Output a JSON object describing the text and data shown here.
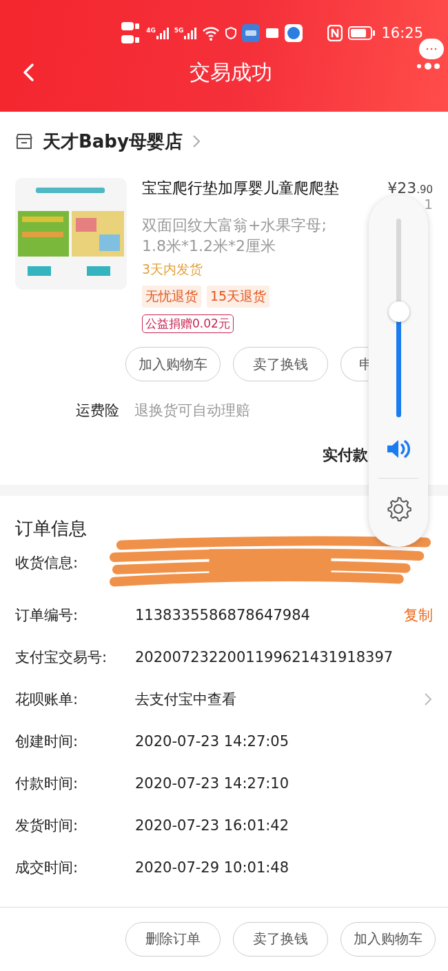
{
  "status_bar": {
    "network_labels": [
      "4G",
      "5G"
    ],
    "time": "16:25"
  },
  "header": {
    "title": "交易成功"
  },
  "shop": {
    "name": "天才Baby母婴店"
  },
  "product": {
    "image": {
      "kind": "picture"
    },
    "title": "宝宝爬行垫加厚婴儿童爬爬垫",
    "price_symbol": "¥",
    "price_integer": "23",
    "price_decimal": ".90",
    "quantity": "1",
    "spec_lines": [
      "双面回纹大富翁+水果字母;",
      "1.8米*1.2米*2厘米"
    ],
    "delivery": "3天内发货",
    "tags": [
      "无忧退货",
      "15天退货"
    ],
    "charity": "公益捐赠0.02元"
  },
  "item_actions": [
    "加入购物车",
    "卖了换钱",
    "申"
  ],
  "insurance": {
    "label": "运费险",
    "text": "退换货可自动理赔"
  },
  "payment": {
    "label": "实付款"
  },
  "order_info": {
    "title": "订单信息",
    "rows": [
      {
        "kind": "redacted",
        "label": "收货信息:"
      },
      {
        "kind": "copy",
        "label": "订单编号:",
        "value": "1138335586878647984",
        "action": "复制"
      },
      {
        "kind": "text",
        "label": "支付宝交易号:",
        "value": "2020072322001199621431918397"
      },
      {
        "kind": "link",
        "label": "花呗账单:",
        "value": "去支付宝中查看"
      },
      {
        "kind": "text",
        "label": "创建时间:",
        "value": "2020-07-23 14:27:05"
      },
      {
        "kind": "text",
        "label": "付款时间:",
        "value": "2020-07-23 14:27:10"
      },
      {
        "kind": "text",
        "label": "发货时间:",
        "value": "2020-07-23 16:01:42"
      },
      {
        "kind": "text",
        "label": "成交时间:",
        "value": "2020-07-29 10:01:48"
      }
    ]
  },
  "footer_actions": [
    "删除订单",
    "卖了换钱",
    "加入购物车"
  ],
  "volume": {
    "level": 0.53
  }
}
